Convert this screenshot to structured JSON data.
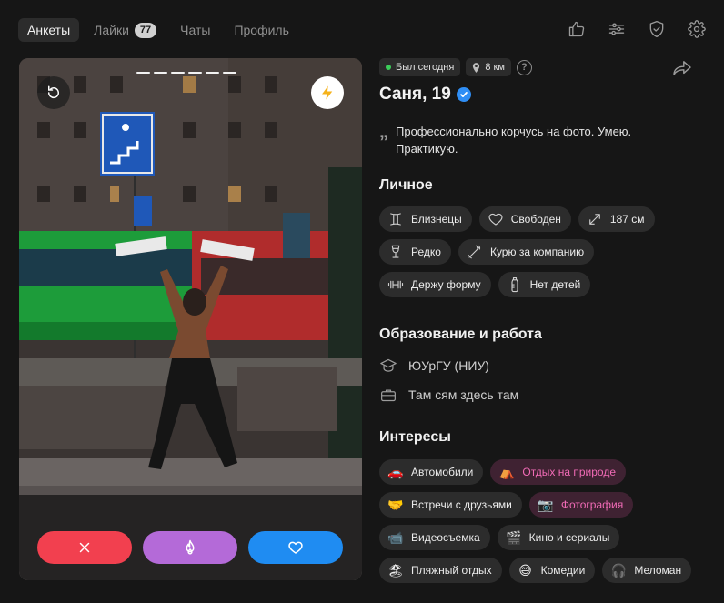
{
  "nav": {
    "tabs": [
      {
        "label": "Анкеты",
        "active": true
      },
      {
        "label": "Лайки",
        "count": "77"
      },
      {
        "label": "Чаты"
      },
      {
        "label": "Профиль"
      }
    ],
    "icons": [
      "thumb-up-icon",
      "filters-icon",
      "shield-check-icon",
      "gear-icon"
    ]
  },
  "photo": {
    "story_count": 6,
    "icons": [
      "undo-icon",
      "lightning-icon"
    ],
    "actions": [
      {
        "name": "dislike",
        "icon": "close-icon",
        "color": "#f2404f"
      },
      {
        "name": "superlike",
        "icon": "fire-icon",
        "color": "#b46ad8"
      },
      {
        "name": "like",
        "icon": "heart-icon",
        "color": "#1f8cf2"
      }
    ]
  },
  "profile": {
    "last_seen": "Был сегодня",
    "distance": "8 км",
    "help": "?",
    "name": "Саня, 19",
    "bio_quote": "„",
    "bio": "Профессионально корчусь на фото. Умею. Практикую.",
    "personal_title": "Личное",
    "personal": [
      {
        "icon": "gemini-icon",
        "label": "Близнецы"
      },
      {
        "icon": "heart-outline-icon",
        "label": "Свободен"
      },
      {
        "icon": "height-icon",
        "label": "187 см"
      },
      {
        "icon": "wine-glass-icon",
        "label": "Редко"
      },
      {
        "icon": "cigarette-icon",
        "label": "Курю за компанию"
      },
      {
        "icon": "dumbbell-icon",
        "label": "Держу форму"
      },
      {
        "icon": "baby-bottle-icon",
        "label": "Нет детей"
      }
    ],
    "edu_title": "Образование и работа",
    "education": "ЮУрГУ (НИУ)",
    "work": "Там сям здесь там",
    "interests_title": "Интересы",
    "interests": [
      {
        "emoji": "🚗",
        "label": "Автомобили",
        "highlight": false
      },
      {
        "emoji": "⛺",
        "label": "Отдых на природе",
        "highlight": true
      },
      {
        "emoji": "🤝",
        "label": "Встречи с друзьями",
        "highlight": false
      },
      {
        "emoji": "📷",
        "label": "Фотография",
        "highlight": true
      },
      {
        "emoji": "📹",
        "label": "Видеосъемка",
        "highlight": false
      },
      {
        "emoji": "🎬",
        "label": "Кино и сериалы",
        "highlight": false
      },
      {
        "emoji": "🏖",
        "label": "Пляжный отдых",
        "highlight": false
      },
      {
        "emoji": "😅",
        "label": "Комедии",
        "highlight": false
      },
      {
        "emoji": "🎧",
        "label": "Меломан",
        "highlight": false
      }
    ]
  }
}
